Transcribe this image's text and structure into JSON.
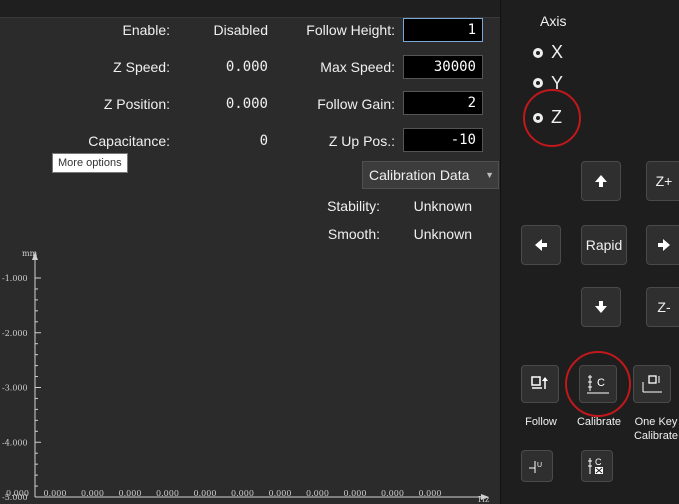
{
  "params": {
    "enable_label": "Enable:",
    "enable_value": "Disabled",
    "zspeed_label": "Z Speed:",
    "zspeed_value": "0.000",
    "zpos_label": "Z Position:",
    "zpos_value": "0.000",
    "cap_label": "Capacitance:",
    "cap_value": "0",
    "follow_height_label": "Follow Height:",
    "follow_height_value": "1",
    "max_speed_label": "Max Speed:",
    "max_speed_value": "30000",
    "follow_gain_label": "Follow Gain:",
    "follow_gain_value": "2",
    "zup_label": "Z Up Pos.:",
    "zup_value": "-10"
  },
  "tooltip": "More options",
  "calibration": {
    "dropdown_label": "Calibration Data",
    "stability_label": "Stability:",
    "stability_value": "Unknown",
    "smooth_label": "Smooth:",
    "smooth_value": "Unknown"
  },
  "chart_data": {
    "type": "line",
    "ylabel": "mm",
    "xlabel": "Hz",
    "y_ticks": [
      "-1.000",
      "-2.000",
      "-3.000",
      "-4.000",
      "-5.000"
    ],
    "x_ticks": [
      "0.000",
      "0.000",
      "0.000",
      "0.000",
      "0.000",
      "0.000",
      "0.000",
      "0.000",
      "0.000",
      "0.000",
      "0.000",
      "0.000"
    ],
    "series": []
  },
  "axis": {
    "title": "Axis",
    "options": [
      "X",
      "Y",
      "Z"
    ],
    "selected": "Z"
  },
  "jog": {
    "zplus": "Z+",
    "zminus": "Z-",
    "rapid": "Rapid"
  },
  "actions": {
    "follow": "Follow",
    "calibrate": "Calibrate",
    "one_key_calibrate_1": "One Key",
    "one_key_calibrate_2": "Calibrate"
  },
  "colors": {
    "highlight_circle": "#c0181b",
    "input_bg": "#000000",
    "panel_bg": "#1e1e1e"
  }
}
